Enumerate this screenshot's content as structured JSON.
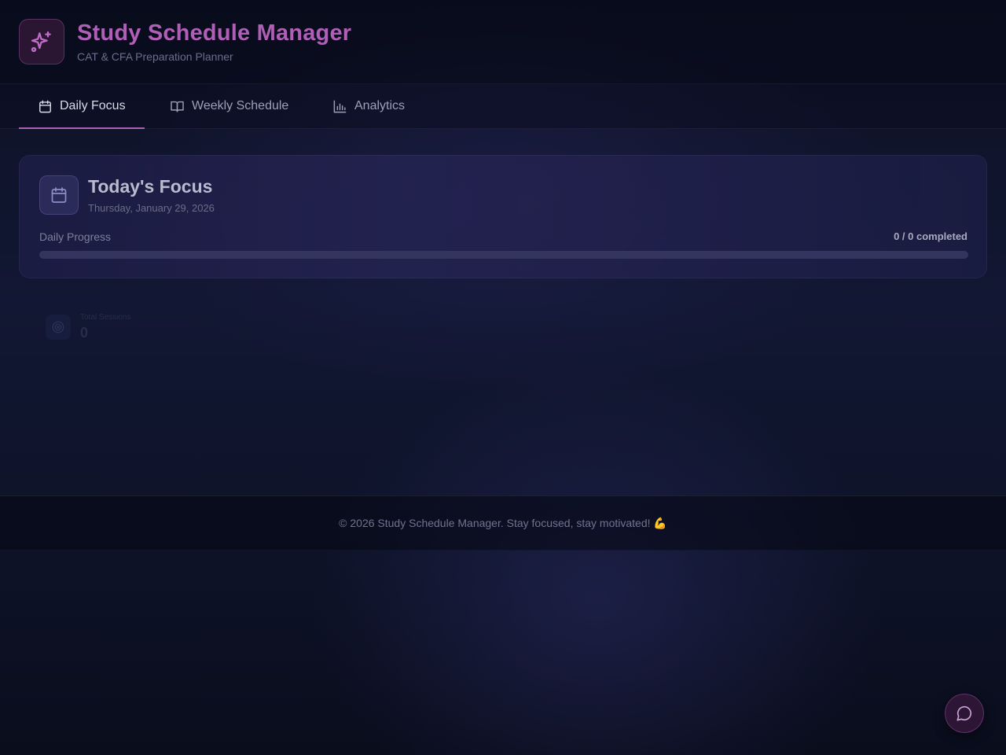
{
  "app": {
    "title": "Study Schedule Manager",
    "subtitle": "CAT & CFA Preparation Planner",
    "logo_icon": "sparkles-icon",
    "brand_color": "#b05fb6"
  },
  "tabs": [
    {
      "label": "Daily Focus",
      "icon": "calendar-icon",
      "active": true
    },
    {
      "label": "Weekly Schedule",
      "icon": "book-open-icon",
      "active": false
    },
    {
      "label": "Analytics",
      "icon": "bar-chart-icon",
      "active": false
    }
  ],
  "focus_card": {
    "title": "Today's Focus",
    "date": "Thursday, January 29, 2026",
    "icon": "calendar-icon",
    "progress_label": "Daily Progress",
    "progress_text": "0 / 0 completed",
    "progress_fraction": 0
  },
  "stats": [
    {
      "label": "Total Sessions",
      "value": "0",
      "icon": "target-icon"
    }
  ],
  "footer": {
    "text": "© 2026 Study Schedule Manager. Stay focused, stay motivated! 💪"
  },
  "chat_button": {
    "icon": "message-circle-icon"
  }
}
